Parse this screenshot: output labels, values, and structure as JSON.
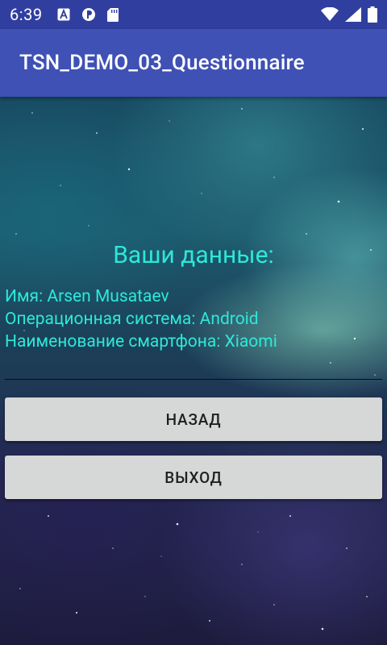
{
  "status_bar": {
    "time": "6:39",
    "icons": [
      "a-icon",
      "vpn-key-icon",
      "sd-card-icon",
      "wifi-icon",
      "signal-icon",
      "battery-icon"
    ]
  },
  "app_bar": {
    "title": "TSN_DEMO_03_Questionnaire",
    "color": "#3f51b5"
  },
  "main": {
    "heading": "Ваши данные:",
    "lines": [
      "Имя: Arsen Musataev",
      "Операционная система: Android",
      "Наименование смартфона: Xiaomi"
    ],
    "text_color": "#2de8d8"
  },
  "buttons": {
    "back_label": "НАЗАД",
    "exit_label": "ВЫХОД"
  }
}
